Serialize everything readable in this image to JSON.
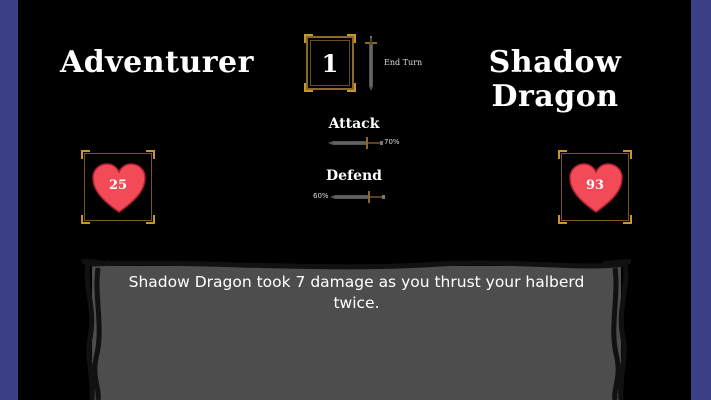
{
  "player": {
    "name": "Adventurer",
    "hp": "25"
  },
  "enemy": {
    "name": "Shadow Dragon",
    "hp": "93"
  },
  "turn": {
    "number": "1",
    "end_turn_label": "End Turn"
  },
  "stats": {
    "attack": {
      "label": "Attack",
      "value": "70%"
    },
    "defend": {
      "label": "Defend",
      "value": "60%"
    }
  },
  "message": "Shadow Dragon took 7 damage as you thrust your halberd twice.",
  "colors": {
    "heart": "#f24b57",
    "frame_gold": "#c9962d",
    "panel": "#4d4d4d",
    "outer": "#3b3f86"
  },
  "icons": [
    "sword-icon",
    "heart-icon"
  ]
}
